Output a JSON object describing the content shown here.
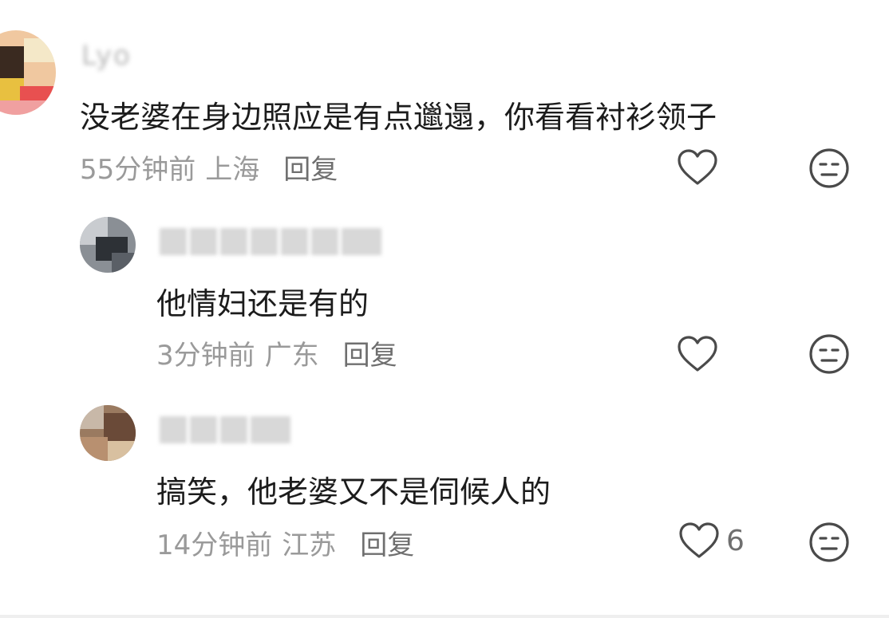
{
  "comments": [
    {
      "username": "Lyo",
      "text": "没老婆在身边照应是有点邋遢，你看看衬衫领子",
      "time": "55分钟前",
      "location": "上海",
      "reply_label": "回复",
      "like_count": ""
    },
    {
      "username": "",
      "text": "他情妇还是有的",
      "time": "3分钟前",
      "location": "广东",
      "reply_label": "回复",
      "like_count": ""
    },
    {
      "username": "",
      "text": "搞笑，他老婆又不是伺候人的",
      "time": "14分钟前",
      "location": "江苏",
      "reply_label": "回复",
      "like_count": "6"
    }
  ],
  "icons": {
    "like": "heart-outline-icon",
    "dislike": "neutral-face-icon"
  },
  "colors": {
    "text_primary": "#1c1c1c",
    "text_meta": "#9a9a9a",
    "icon_stroke": "#4a4a4a"
  }
}
